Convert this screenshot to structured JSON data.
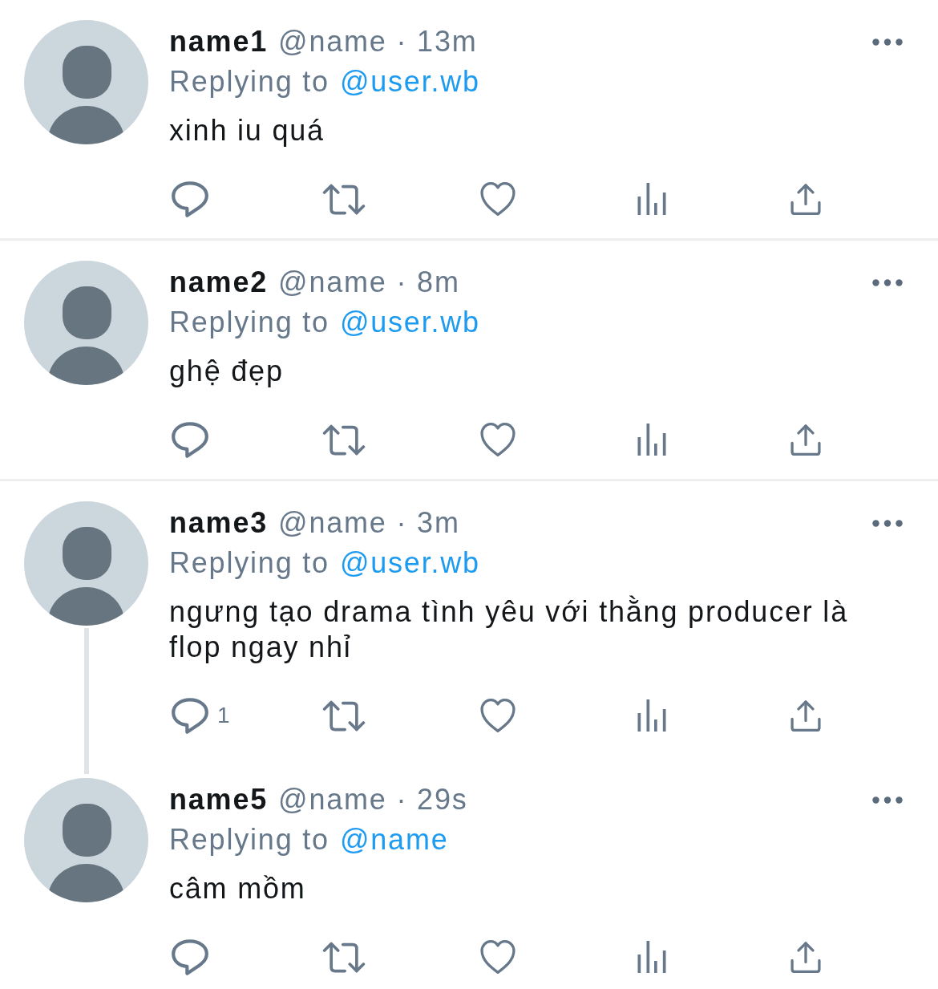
{
  "replies": [
    {
      "name": "name1",
      "handle_time": "@name · 13m",
      "replying_label": "Replying to",
      "replying_to": "@user.wb",
      "text": "xinh iu quá",
      "thread_continues": false
    },
    {
      "name": "name2",
      "handle_time": "@name · 8m",
      "replying_label": "Replying to",
      "replying_to": "@user.wb",
      "text": "ghệ đẹp",
      "thread_continues": false
    },
    {
      "name": "name3",
      "handle_time": "@name · 3m",
      "replying_label": "Replying to",
      "replying_to": "@user.wb",
      "text": "ngưng tạo drama tình yêu với thằng producer là flop ngay nhỉ",
      "reply_count": "1",
      "thread_continues": true
    },
    {
      "name": "name5",
      "handle_time": "@name · 29s",
      "replying_label": "Replying to",
      "replying_to": "@name",
      "text": "câm mồm",
      "thread_continues": false
    }
  ]
}
